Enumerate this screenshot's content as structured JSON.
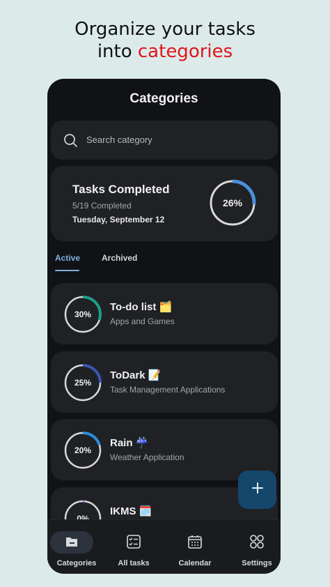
{
  "headline": {
    "line1": "Organize your tasks",
    "line2_prefix": "into ",
    "line2_accent": "categories"
  },
  "screen": {
    "title": "Categories"
  },
  "search": {
    "placeholder": "Search category"
  },
  "summary": {
    "title": "Tasks Completed",
    "subtitle": "5/19 Completed",
    "date": "Tuesday, September 12",
    "percent_label": "26%",
    "progress": 0.26,
    "color": "#4a90d9"
  },
  "tabs": [
    {
      "label": "Active",
      "selected": true
    },
    {
      "label": "Archived",
      "selected": false
    }
  ],
  "categories": [
    {
      "name": "To-do list 🗂️",
      "description": "Apps and Games",
      "percent_label": "30%",
      "progress": 0.3,
      "color": "#1f9e8a"
    },
    {
      "name": "ToDark 📝",
      "description": "Task Management Applications",
      "percent_label": "25%",
      "progress": 0.25,
      "color": "#3b55b5"
    },
    {
      "name": "Rain ☔",
      "description": "Weather Application",
      "percent_label": "20%",
      "progress": 0.2,
      "color": "#2b8fe0"
    },
    {
      "name": "IKMS 🗓️",
      "description": "",
      "percent_label": "0%",
      "progress": 0.0,
      "color": "#7c4dd6"
    }
  ],
  "fab": {
    "icon": "plus-icon"
  },
  "bottom_nav": [
    {
      "label": "Categories",
      "icon": "folder-icon",
      "selected": true
    },
    {
      "label": "All tasks",
      "icon": "checklist-icon",
      "selected": false
    },
    {
      "label": "Calendar",
      "icon": "calendar-icon",
      "selected": false
    },
    {
      "label": "Settings",
      "icon": "grid-icon",
      "selected": false
    }
  ]
}
